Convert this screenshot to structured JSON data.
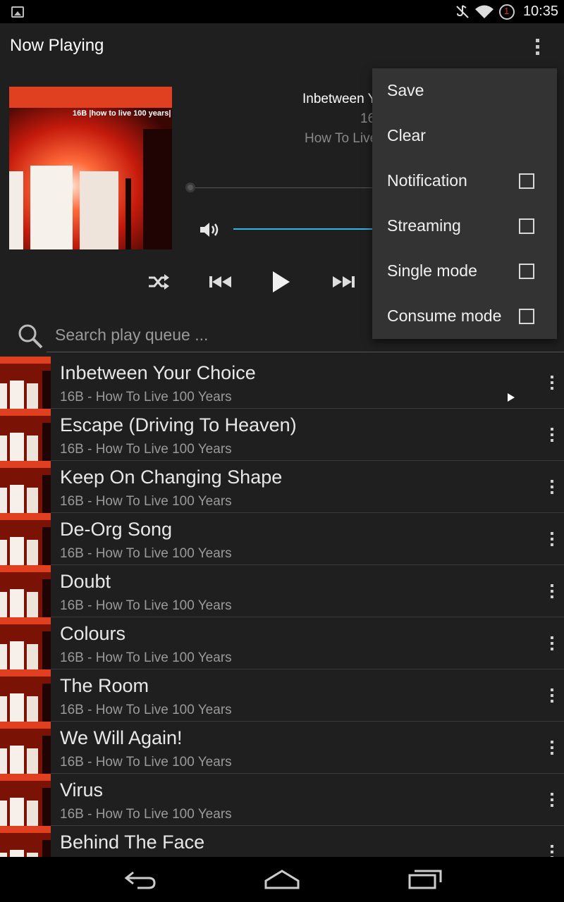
{
  "status_bar": {
    "time": "10:35",
    "alert_count": "1",
    "icons": [
      "gallery-icon",
      "mute-icon",
      "wifi-icon",
      "alert-icon"
    ]
  },
  "action_bar": {
    "title": "Now Playing",
    "overflow_icon": "overflow-menu-icon"
  },
  "now_playing": {
    "album_cover_text": "16B |how to live 100 years|",
    "title_visible": "Inbetween Y",
    "artist_visible": "16",
    "album_visible": "How To Live"
  },
  "controls": {
    "icons": [
      "shuffle-icon",
      "previous-icon",
      "play-icon",
      "next-icon"
    ],
    "volume_icon": "volume-icon"
  },
  "search": {
    "placeholder": "Search play queue ..."
  },
  "queue": [
    {
      "title": "Inbetween Your Choice",
      "subtitle": "16B - How To Live 100 Years",
      "playing": true
    },
    {
      "title": "Escape (Driving To Heaven)",
      "subtitle": "16B - How To Live 100 Years"
    },
    {
      "title": "Keep On Changing Shape",
      "subtitle": "16B - How To Live 100 Years"
    },
    {
      "title": "De-Org Song",
      "subtitle": "16B - How To Live 100 Years"
    },
    {
      "title": "Doubt",
      "subtitle": "16B - How To Live 100 Years"
    },
    {
      "title": "Colours",
      "subtitle": "16B - How To Live 100 Years"
    },
    {
      "title": "The Room",
      "subtitle": "16B - How To Live 100 Years"
    },
    {
      "title": "We Will Again!",
      "subtitle": "16B - How To Live 100 Years"
    },
    {
      "title": "Virus",
      "subtitle": "16B - How To Live 100 Years"
    },
    {
      "title": "Behind The Face",
      "subtitle": ""
    }
  ],
  "menu": {
    "items": [
      {
        "label": "Save"
      },
      {
        "label": "Clear"
      },
      {
        "label": "Notification",
        "checked": false
      },
      {
        "label": "Streaming",
        "checked": false
      },
      {
        "label": "Single mode",
        "checked": false
      },
      {
        "label": "Consume mode",
        "checked": false
      }
    ]
  },
  "nav_bar": {
    "icons": [
      "back-icon",
      "home-icon",
      "recents-icon"
    ]
  },
  "colors": {
    "accent": "#33b5e5",
    "background": "#1f1f1f",
    "menu_background": "#333333"
  }
}
